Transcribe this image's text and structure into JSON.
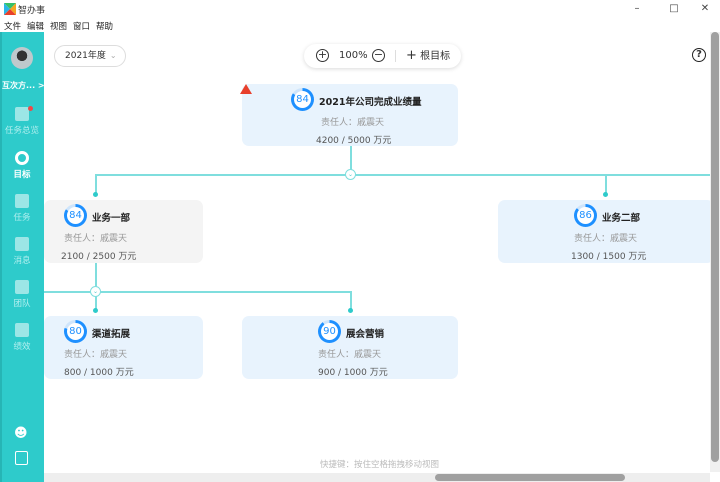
{
  "app": {
    "title": "智办事",
    "menu": [
      "文件",
      "编辑",
      "视图",
      "窗口",
      "帮助"
    ],
    "accent": "#2ecbcb"
  },
  "sidebar": {
    "user": "互次方...",
    "items": [
      {
        "label": "任务总览",
        "icon": "chart-icon",
        "badge": true
      },
      {
        "label": "目标",
        "icon": "target-icon",
        "active": true
      },
      {
        "label": "任务",
        "icon": "list-icon"
      },
      {
        "label": "消息",
        "icon": "message-icon"
      },
      {
        "label": "团队",
        "icon": "team-icon"
      },
      {
        "label": "绩效",
        "icon": "performance-icon"
      }
    ]
  },
  "toolbar": {
    "year": "2021年度",
    "zoom": "100%",
    "root_label": "根目标"
  },
  "cards": [
    {
      "progress": 84,
      "title": "2021年公司完成业绩量",
      "owner": "责任人：戚震天",
      "value": "4200 / 5000 万元",
      "warning": true
    },
    {
      "progress": 84,
      "title": "业务一部",
      "owner": "责任人：戚震天",
      "value": "2100 / 2500 万元"
    },
    {
      "progress": 86,
      "title": "业务二部",
      "owner": "责任人：戚震天",
      "value": "1300 / 1500 万元"
    },
    {
      "progress": 80,
      "title": "渠道拓展",
      "owner": "责任人：戚震天",
      "value": "800 / 1000 万元"
    },
    {
      "progress": 90,
      "title": "展会营销",
      "owner": "责任人：戚震天",
      "value": "900 / 1000 万元"
    }
  ],
  "hint": "快捷键：按住空格拖拽移动视图"
}
